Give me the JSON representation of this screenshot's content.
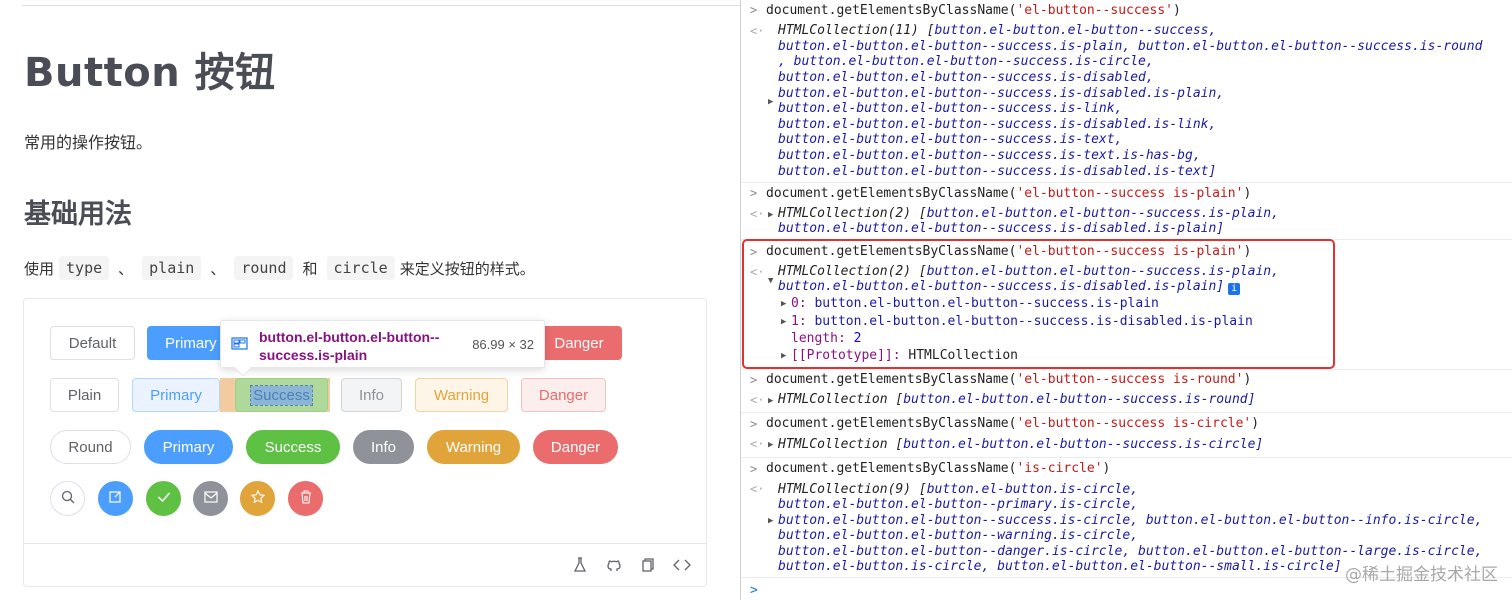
{
  "doc": {
    "title": "Button 按钮",
    "description": "常用的操作按钮。",
    "section_title": "基础用法",
    "usage": {
      "prefix": "使用",
      "code1": "type",
      "sep1": "、",
      "code2": "plain",
      "sep2": "、",
      "code3": "round",
      "and": "和",
      "code4": "circle",
      "suffix": "来定义按钮的样式。"
    },
    "row1": [
      "Default",
      "Primary",
      "Danger"
    ],
    "row2": [
      "Plain",
      "Primary",
      "Success",
      "Info",
      "Warning",
      "Danger"
    ],
    "row3": [
      "Round",
      "Primary",
      "Success",
      "Info",
      "Warning",
      "Danger"
    ],
    "row4_icons": [
      "search-icon",
      "edit-icon",
      "check-icon",
      "message-icon",
      "star-icon",
      "delete-icon"
    ],
    "tooltip": {
      "selector": "button.el-button.el-button--success.is-plain",
      "size": "86.99 × 32"
    },
    "colors": {
      "primary": "#4c9efe",
      "success": "#5ec144",
      "info": "#8f9298",
      "warning": "#e1a43b",
      "danger": "#eb6c6c"
    }
  },
  "console": {
    "e1": {
      "cmd_prefix": "document.getElementsByClassName(",
      "cmd_arg": "'el-button--success'",
      "cmd_suffix": ")",
      "r0": "HTMLCollection(11) [",
      "r0b": "button.el-button.el-button--success,",
      "r1": "button.el-button.el-button--success.is-plain, button.el-button.el-button--success.is-round",
      "r2": ", button.el-button.el-button--success.is-circle,",
      "r3": "button.el-button.el-button--success.is-disabled,",
      "r4": "button.el-button.el-button--success.is-disabled.is-plain,",
      "r5": "button.el-button.el-button--success.is-link,",
      "r6": "button.el-button.el-button--success.is-disabled.is-link,",
      "r7": "button.el-button.el-button--success.is-text,",
      "r8": "button.el-button.el-button--success.is-text.is-has-bg,",
      "r9": "button.el-button.el-button--success.is-disabled.is-text]"
    },
    "e2": {
      "cmd_arg": "'el-button--success is-plain'",
      "r0": "HTMLCollection(2) [",
      "r0b": "button.el-button.el-button--success.is-plain,",
      "r1": "button.el-button.el-button--success.is-disabled.is-plain]"
    },
    "e3": {
      "cmd_arg": "'el-button--success is-plain'",
      "r0": "HTMLCollection(2) [",
      "r0b": "button.el-button.el-button--success.is-plain,",
      "r1": "button.el-button.el-button--success.is-disabled.is-plain]",
      "badge": "i",
      "k0": "0",
      "v0": "button.el-button.el-button--success.is-plain",
      "k1": "1",
      "v1": "button.el-button.el-button--success.is-disabled.is-plain",
      "len_key": "length",
      "len_val": "2",
      "proto_key": "[[Prototype]]",
      "proto_val": "HTMLCollection"
    },
    "e4": {
      "cmd_arg": "'el-button--success is-round'",
      "r0": "HTMLCollection [",
      "r0b": "button.el-button.el-button--success.is-round]"
    },
    "e5": {
      "cmd_arg": "'el-button--success is-circle'",
      "r0": "HTMLCollection [",
      "r0b": "button.el-button.el-button--success.is-circle]"
    },
    "e6": {
      "cmd_arg": "'is-circle'",
      "r0": "HTMLCollection(9) [",
      "r0b": "button.el-button.is-circle,",
      "r1": "button.el-button.el-button--primary.is-circle,",
      "r2": "button.el-button.el-button--success.is-circle, button.el-button.el-button--info.is-circle,",
      "r3": "button.el-button.el-button--warning.is-circle,",
      "r4": "button.el-button.el-button--danger.is-circle, button.el-button.el-button--large.is-circle,",
      "r5": "button.el-button.is-circle, button.el-button.el-button--small.is-circle]"
    },
    "watermark": "@稀土掘金技术社区"
  }
}
